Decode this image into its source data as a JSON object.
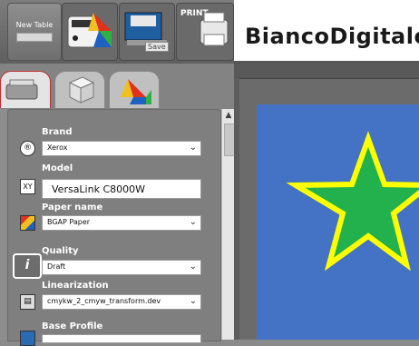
{
  "toolbar": {
    "new_table_label": "New Table",
    "save_label": "Save",
    "print_label": "PRINT"
  },
  "app": {
    "brand": "BiancoDigitale"
  },
  "panel": {
    "brand": {
      "label": "Brand",
      "value": "Xerox"
    },
    "model": {
      "label": "Model",
      "value": "VersaLink C8000W"
    },
    "paper": {
      "label": "Paper name",
      "value": "BGAP Paper"
    },
    "quality": {
      "label": "Quality",
      "value": "Draft"
    },
    "linearization": {
      "label": "Linearization",
      "value": "cmykw_2_cmyw_transform.dev"
    },
    "base_profile": {
      "label": "Base Profile"
    }
  },
  "icons": {
    "brand": "registered-icon",
    "model": "xy-icon",
    "paper": "paper-color-icon",
    "quality": "info-icon",
    "linearization": "linearization-icon"
  },
  "colors": {
    "canvas_bg": "#4472c4",
    "star_fill": "#22b14c",
    "star_outline": "#ffff00"
  }
}
